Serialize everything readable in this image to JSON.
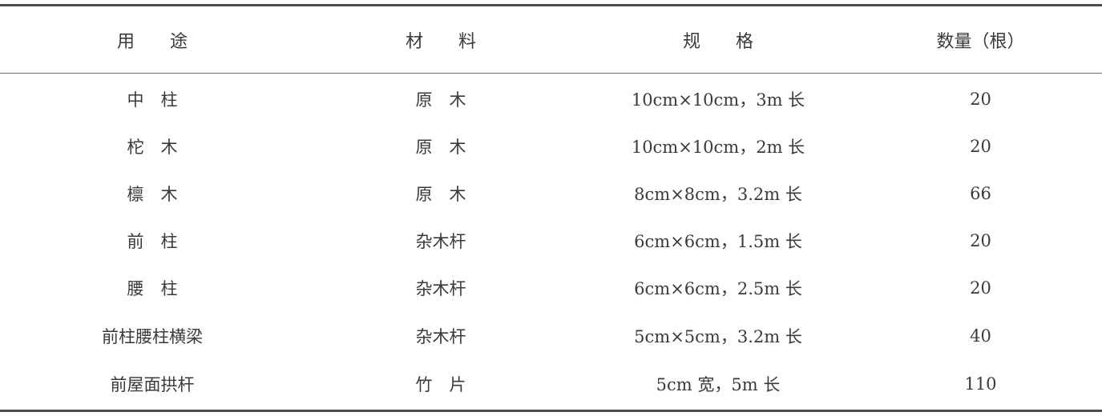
{
  "table": {
    "headers": [
      "用　　途",
      "材　　料",
      "规　　格",
      "数量（根）"
    ],
    "rows": [
      [
        "中　柱",
        "原　木",
        "10cm×10cm，3m 长",
        "20"
      ],
      [
        "柁　木",
        "原　木",
        "10cm×10cm，2m 长",
        "20"
      ],
      [
        "檩　木",
        "原　木",
        "8cm×8cm，3.2m 长",
        "66"
      ],
      [
        "前　柱",
        "杂木杆",
        "6cm×6cm，1.5m 长",
        "20"
      ],
      [
        "腰　柱",
        "杂木杆",
        "6cm×6cm，2.5m 长",
        "20"
      ],
      [
        "前柱腰柱横梁",
        "杂木杆",
        "5cm×5cm，3.2m 长",
        "40"
      ],
      [
        "前屋面拱杆",
        "竹　片",
        "5cm 宽，5m 长",
        "110"
      ]
    ]
  }
}
